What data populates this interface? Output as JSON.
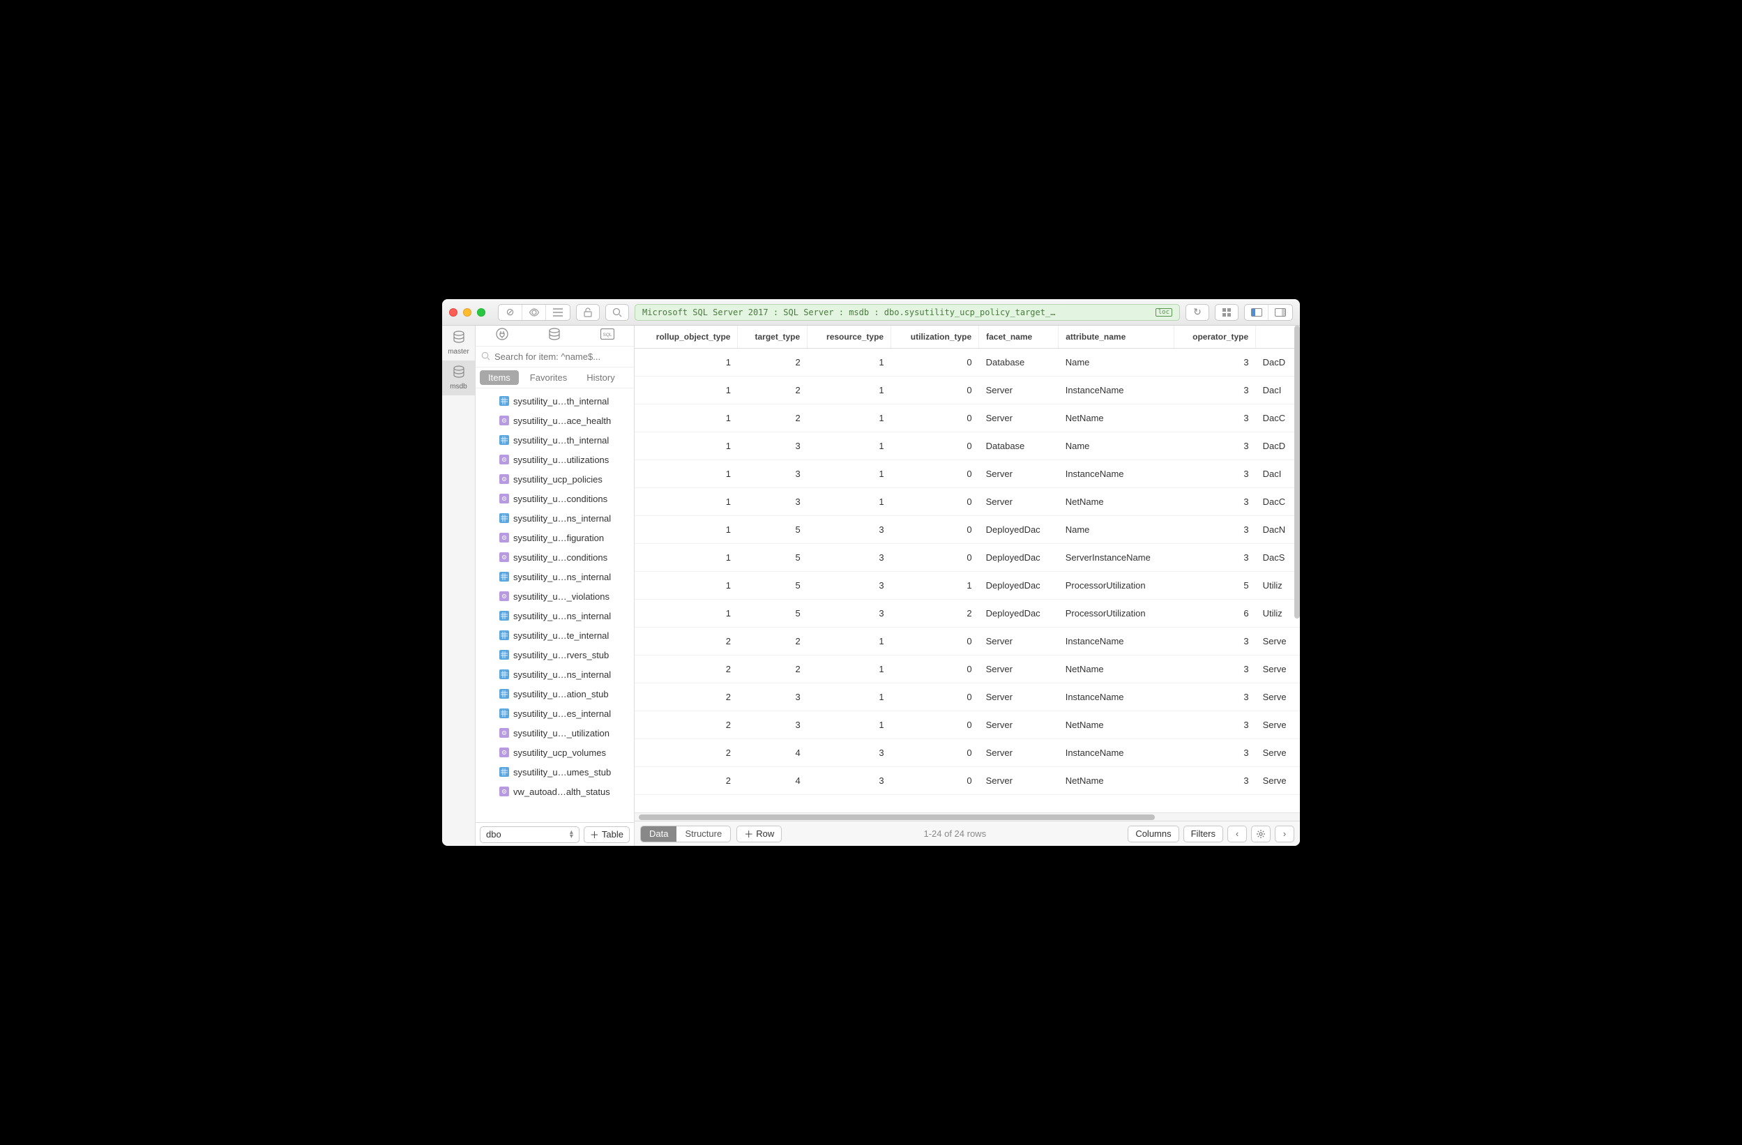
{
  "titlebar": {
    "breadcrumb": "Microsoft SQL Server 2017 : SQL Server : msdb : dbo.sysutility_ucp_policy_target_…",
    "loc_badge": "loc"
  },
  "dbrail": {
    "items": [
      {
        "label": "master"
      },
      {
        "label": "msdb"
      }
    ]
  },
  "sidebar": {
    "search_placeholder": "Search for item: ^name$...",
    "tabs": {
      "items": "Items",
      "favorites": "Favorites",
      "history": "History"
    },
    "tree": [
      {
        "icon": "table",
        "label": "sysutility_u…th_internal"
      },
      {
        "icon": "view",
        "label": "sysutility_u…ace_health"
      },
      {
        "icon": "table",
        "label": "sysutility_u…th_internal"
      },
      {
        "icon": "view",
        "label": "sysutility_u…utilizations"
      },
      {
        "icon": "view",
        "label": "sysutility_ucp_policies"
      },
      {
        "icon": "view",
        "label": "sysutility_u…conditions"
      },
      {
        "icon": "table",
        "label": "sysutility_u…ns_internal"
      },
      {
        "icon": "view",
        "label": "sysutility_u…figuration"
      },
      {
        "icon": "view",
        "label": "sysutility_u…conditions"
      },
      {
        "icon": "table",
        "label": "sysutility_u…ns_internal"
      },
      {
        "icon": "view",
        "label": "sysutility_u…_violations"
      },
      {
        "icon": "table",
        "label": "sysutility_u…ns_internal"
      },
      {
        "icon": "table",
        "label": "sysutility_u…te_internal"
      },
      {
        "icon": "table",
        "label": "sysutility_u…rvers_stub"
      },
      {
        "icon": "table",
        "label": "sysutility_u…ns_internal"
      },
      {
        "icon": "table",
        "label": "sysutility_u…ation_stub"
      },
      {
        "icon": "table",
        "label": "sysutility_u…es_internal"
      },
      {
        "icon": "view",
        "label": "sysutility_u…_utilization"
      },
      {
        "icon": "view",
        "label": "sysutility_ucp_volumes"
      },
      {
        "icon": "table",
        "label": "sysutility_u…umes_stub"
      },
      {
        "icon": "view",
        "label": "vw_autoad…alth_status"
      }
    ],
    "schema": "dbo",
    "add_table": "Table"
  },
  "grid": {
    "columns": [
      {
        "key": "rollup_object_type",
        "label": "rollup_object_type",
        "type": "num"
      },
      {
        "key": "target_type",
        "label": "target_type",
        "type": "num"
      },
      {
        "key": "resource_type",
        "label": "resource_type",
        "type": "num"
      },
      {
        "key": "utilization_type",
        "label": "utilization_type",
        "type": "num"
      },
      {
        "key": "facet_name",
        "label": "facet_name",
        "type": "text"
      },
      {
        "key": "attribute_name",
        "label": "attribute_name",
        "type": "text"
      },
      {
        "key": "operator_type",
        "label": "operator_type",
        "type": "num"
      },
      {
        "key": "trunc",
        "label": "",
        "type": "text"
      }
    ],
    "rows": [
      {
        "rollup_object_type": 1,
        "target_type": 2,
        "resource_type": 1,
        "utilization_type": 0,
        "facet_name": "Database",
        "attribute_name": "Name",
        "operator_type": 3,
        "trunc": "DacD"
      },
      {
        "rollup_object_type": 1,
        "target_type": 2,
        "resource_type": 1,
        "utilization_type": 0,
        "facet_name": "Server",
        "attribute_name": "InstanceName",
        "operator_type": 3,
        "trunc": "DacI"
      },
      {
        "rollup_object_type": 1,
        "target_type": 2,
        "resource_type": 1,
        "utilization_type": 0,
        "facet_name": "Server",
        "attribute_name": "NetName",
        "operator_type": 3,
        "trunc": "DacC"
      },
      {
        "rollup_object_type": 1,
        "target_type": 3,
        "resource_type": 1,
        "utilization_type": 0,
        "facet_name": "Database",
        "attribute_name": "Name",
        "operator_type": 3,
        "trunc": "DacD"
      },
      {
        "rollup_object_type": 1,
        "target_type": 3,
        "resource_type": 1,
        "utilization_type": 0,
        "facet_name": "Server",
        "attribute_name": "InstanceName",
        "operator_type": 3,
        "trunc": "DacI"
      },
      {
        "rollup_object_type": 1,
        "target_type": 3,
        "resource_type": 1,
        "utilization_type": 0,
        "facet_name": "Server",
        "attribute_name": "NetName",
        "operator_type": 3,
        "trunc": "DacC"
      },
      {
        "rollup_object_type": 1,
        "target_type": 5,
        "resource_type": 3,
        "utilization_type": 0,
        "facet_name": "DeployedDac",
        "attribute_name": "Name",
        "operator_type": 3,
        "trunc": "DacN"
      },
      {
        "rollup_object_type": 1,
        "target_type": 5,
        "resource_type": 3,
        "utilization_type": 0,
        "facet_name": "DeployedDac",
        "attribute_name": "ServerInstanceName",
        "operator_type": 3,
        "trunc": "DacS"
      },
      {
        "rollup_object_type": 1,
        "target_type": 5,
        "resource_type": 3,
        "utilization_type": 1,
        "facet_name": "DeployedDac",
        "attribute_name": "ProcessorUtilization",
        "operator_type": 5,
        "trunc": "Utiliz"
      },
      {
        "rollup_object_type": 1,
        "target_type": 5,
        "resource_type": 3,
        "utilization_type": 2,
        "facet_name": "DeployedDac",
        "attribute_name": "ProcessorUtilization",
        "operator_type": 6,
        "trunc": "Utiliz"
      },
      {
        "rollup_object_type": 2,
        "target_type": 2,
        "resource_type": 1,
        "utilization_type": 0,
        "facet_name": "Server",
        "attribute_name": "InstanceName",
        "operator_type": 3,
        "trunc": "Serve"
      },
      {
        "rollup_object_type": 2,
        "target_type": 2,
        "resource_type": 1,
        "utilization_type": 0,
        "facet_name": "Server",
        "attribute_name": "NetName",
        "operator_type": 3,
        "trunc": "Serve"
      },
      {
        "rollup_object_type": 2,
        "target_type": 3,
        "resource_type": 1,
        "utilization_type": 0,
        "facet_name": "Server",
        "attribute_name": "InstanceName",
        "operator_type": 3,
        "trunc": "Serve"
      },
      {
        "rollup_object_type": 2,
        "target_type": 3,
        "resource_type": 1,
        "utilization_type": 0,
        "facet_name": "Server",
        "attribute_name": "NetName",
        "operator_type": 3,
        "trunc": "Serve"
      },
      {
        "rollup_object_type": 2,
        "target_type": 4,
        "resource_type": 3,
        "utilization_type": 0,
        "facet_name": "Server",
        "attribute_name": "InstanceName",
        "operator_type": 3,
        "trunc": "Serve"
      },
      {
        "rollup_object_type": 2,
        "target_type": 4,
        "resource_type": 3,
        "utilization_type": 0,
        "facet_name": "Server",
        "attribute_name": "NetName",
        "operator_type": 3,
        "trunc": "Serve"
      }
    ]
  },
  "footer": {
    "data": "Data",
    "structure": "Structure",
    "add_row": "Row",
    "status": "1-24 of 24 rows",
    "columns": "Columns",
    "filters": "Filters"
  }
}
